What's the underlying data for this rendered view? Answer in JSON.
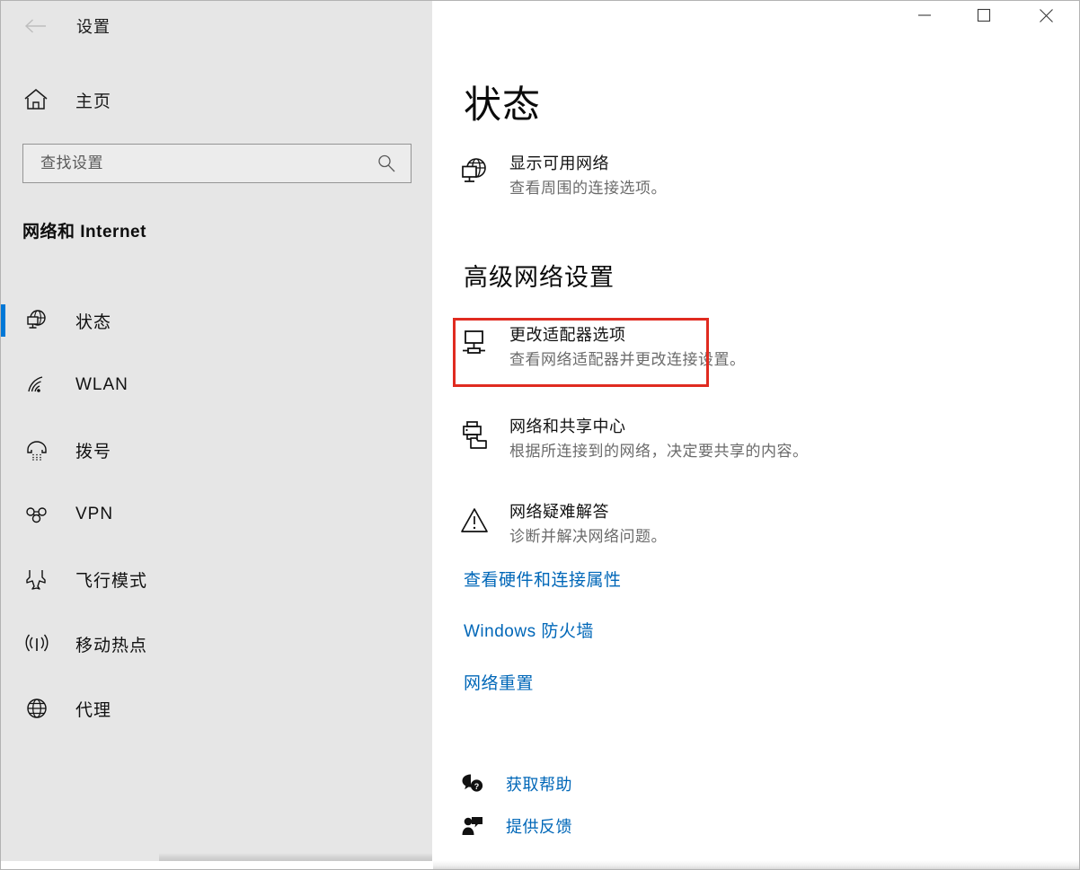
{
  "window": {
    "title": "设置",
    "back_tooltip": "返回",
    "controls": {
      "minimize": "最小化",
      "maximize": "最大化",
      "close": "关闭"
    }
  },
  "sidebar": {
    "home_label": "主页",
    "search": {
      "placeholder": "查找设置",
      "value": ""
    },
    "category_heading": "网络和 Internet",
    "items": [
      {
        "label": "状态",
        "icon": "network-status-icon",
        "selected": true
      },
      {
        "label": "WLAN",
        "icon": "wifi-icon",
        "selected": false
      },
      {
        "label": "拨号",
        "icon": "dialup-phone-icon",
        "selected": false
      },
      {
        "label": "VPN",
        "icon": "vpn-icon",
        "selected": false
      },
      {
        "label": "飞行模式",
        "icon": "airplane-icon",
        "selected": false
      },
      {
        "label": "移动热点",
        "icon": "hotspot-icon",
        "selected": false
      },
      {
        "label": "代理",
        "icon": "globe-icon",
        "selected": false
      }
    ]
  },
  "main": {
    "page_title": "状态",
    "show_available_networks": {
      "title": "显示可用网络",
      "subtitle": "查看周围的连接选项。",
      "icon": "monitor-globe-icon"
    },
    "advanced_heading": "高级网络设置",
    "advanced_items": [
      {
        "title": "更改适配器选项",
        "subtitle": "查看网络适配器并更改连接设置。",
        "icon": "adapter-monitor-icon",
        "highlighted": true
      },
      {
        "title": "网络和共享中心",
        "subtitle": "根据所连接到的网络，决定要共享的内容。",
        "icon": "printer-folder-icon",
        "highlighted": false
      },
      {
        "title": "网络疑难解答",
        "subtitle": "诊断并解决网络问题。",
        "icon": "warning-triangle-icon",
        "highlighted": false
      }
    ],
    "links": [
      {
        "label": "查看硬件和连接属性"
      },
      {
        "label": "Windows 防火墙"
      },
      {
        "label": "网络重置"
      }
    ],
    "footer_links": [
      {
        "label": "获取帮助",
        "icon": "help-chat-icon"
      },
      {
        "label": "提供反馈",
        "icon": "feedback-person-icon"
      }
    ]
  },
  "colors": {
    "accent": "#0078d7",
    "link": "#0067b8",
    "highlight": "#e02b20",
    "sidebar_bg": "#e6e6e6",
    "content_bg": "#ffffff"
  }
}
